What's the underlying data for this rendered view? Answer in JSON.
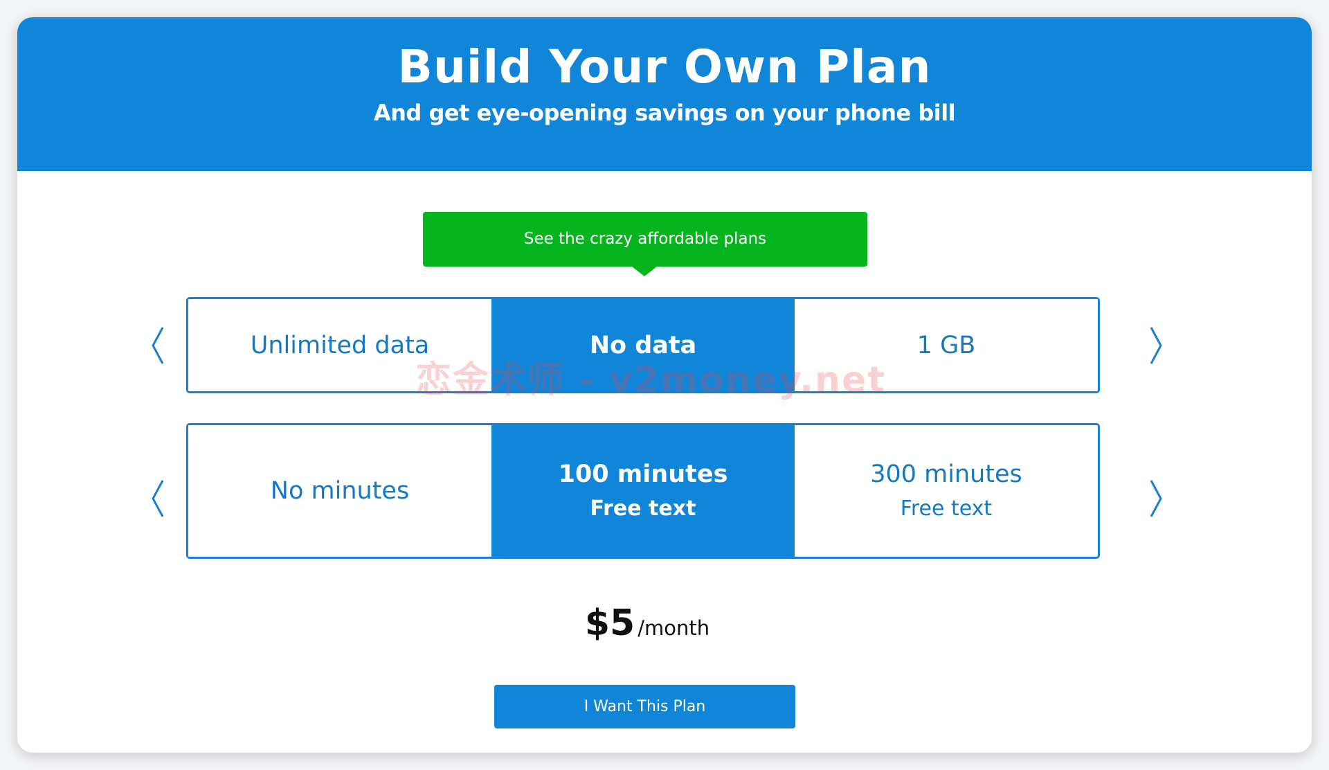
{
  "header": {
    "title": "Build Your Own Plan",
    "subtitle": "And get eye-opening savings on your phone bill"
  },
  "promo": {
    "label": "See the crazy affordable plans"
  },
  "data_selector": {
    "options": [
      {
        "label": "Unlimited data",
        "selected": false
      },
      {
        "label": "No data",
        "selected": true
      },
      {
        "label": "1 GB",
        "selected": false
      }
    ]
  },
  "minutes_selector": {
    "options": [
      {
        "label": "No minutes",
        "sub": "",
        "selected": false
      },
      {
        "label": "100 minutes",
        "sub": "Free text",
        "selected": true
      },
      {
        "label": "300 minutes",
        "sub": "Free text",
        "selected": false
      }
    ]
  },
  "price": {
    "amount": "$5",
    "unit": "/month"
  },
  "cta": {
    "label": "I Want This Plan"
  },
  "watermark": {
    "text": "恋金术师 - v2money.net"
  },
  "colors": {
    "brand_blue": "#1185d8",
    "promo_green": "#06b41e",
    "border_blue": "#1a7fd0"
  },
  "icons": {
    "prev": "chevron-left-icon",
    "next": "chevron-right-icon"
  }
}
